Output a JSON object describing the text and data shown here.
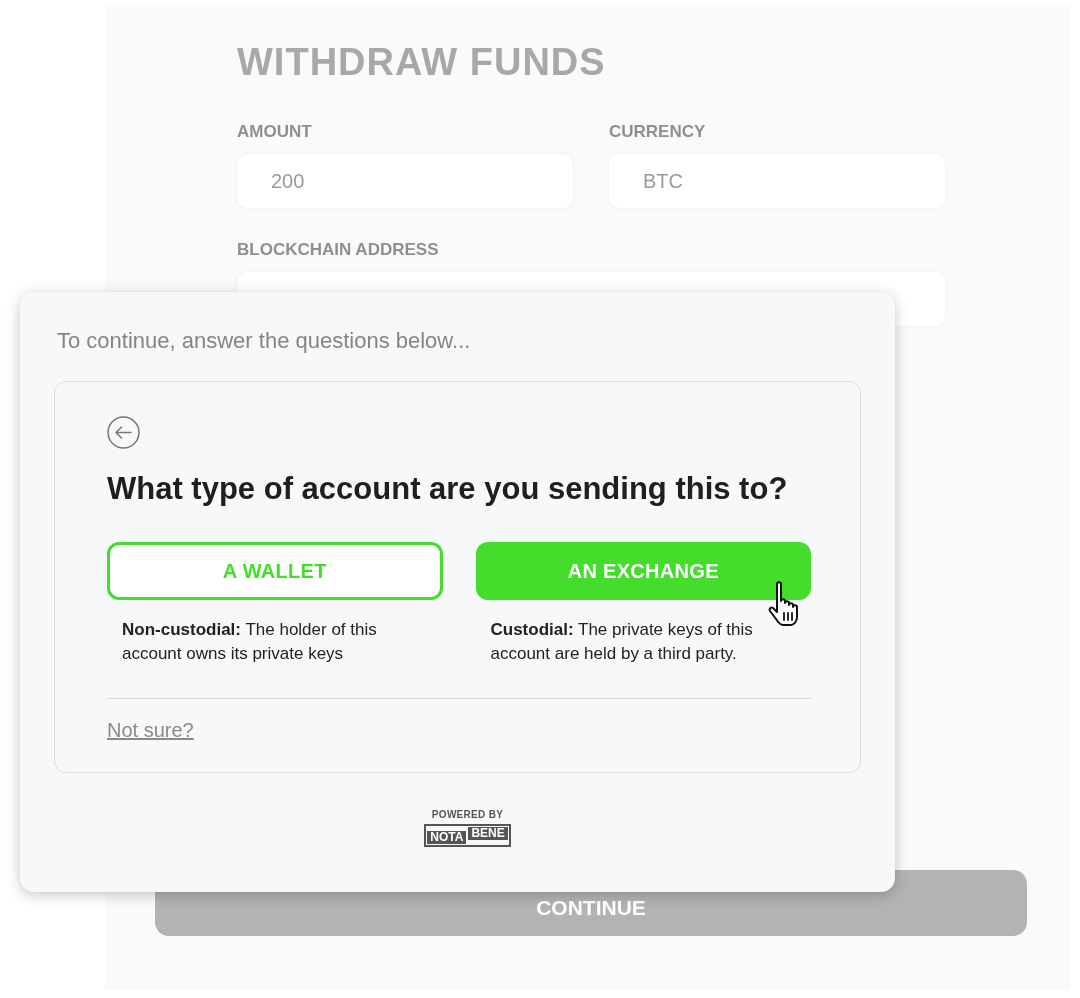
{
  "background_form": {
    "title": "WITHDRAW FUNDS",
    "fields": [
      {
        "label": "AMOUNT",
        "value": "200"
      },
      {
        "label": "CURRENCY",
        "value": "BTC"
      }
    ],
    "address_label": "BLOCKCHAIN ADDRESS",
    "continue_button": "CONTINUE"
  },
  "modal": {
    "prompt": "To continue, answer the questions below...",
    "question": "What type of account are you sending this to?",
    "options": [
      {
        "label": "A WALLET",
        "selected": false,
        "description": "**Non-custodial:** The holder of this account owns its private keys"
      },
      {
        "label": "AN EXCHANGE",
        "selected": true,
        "description": "**Custodial:** The private keys of this account are held by a third party."
      }
    ],
    "not_sure_link": "Not sure?",
    "powered_by": "POWERED BY",
    "logo": {
      "left": "NOTA",
      "right": "BENE"
    }
  }
}
